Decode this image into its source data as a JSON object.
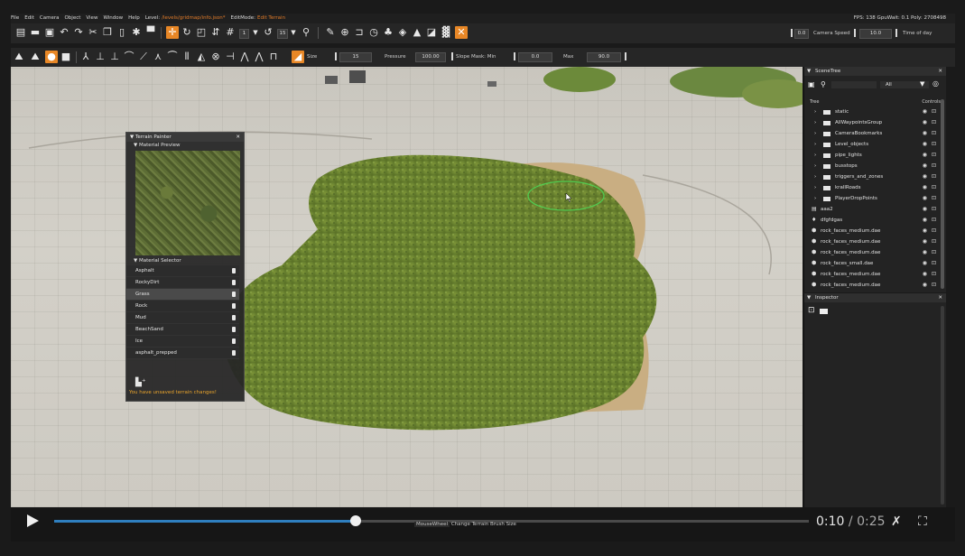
{
  "menubar": {
    "items": [
      "File",
      "Edit",
      "Camera",
      "Object",
      "View",
      "Window",
      "Help"
    ],
    "level_label": "Level:",
    "level_value": "/levels/gridmap/info.json*",
    "editmode_label": "EditMode:",
    "editmode_value": "Edit Terrain",
    "stats": "FPS: 138  GpuWait: 0.1  Poly: 2708498"
  },
  "toolbar1": {
    "num_a": "1",
    "num_b": "15",
    "camera_value": "0.0",
    "camera_speed_label": "Camera Speed",
    "camera_speed_value": "10.0",
    "time_of_day_label": "Time of day"
  },
  "toolbar2": {
    "size_label": "Size",
    "size_value": "15",
    "pressure_label": "Pressure",
    "pressure_value": "100.00",
    "slope_label": "Slope Mask: Min",
    "slope_min": "0.0",
    "max_label": "Max",
    "slope_max": "90.0"
  },
  "terrain_painter": {
    "title": "Terrain Painter",
    "close": "✕",
    "preview_header": "Material Preview",
    "selector_header": "Material Selector",
    "materials": [
      "Asphalt",
      "RockyDirt",
      "Grass",
      "Rock",
      "Mud",
      "BeachSand",
      "Ice",
      "asphalt_prepped"
    ],
    "selected": "Grass",
    "warning": "You have unsaved terrain changes!"
  },
  "scenetree": {
    "title": "SceneTree",
    "close": "✕",
    "filter": "All",
    "col_tree": "Tree",
    "col_controls": "Controls",
    "folders": [
      "static",
      "AllWaypointsGroup",
      "CameraBookmarks",
      "Level_objects",
      "pipe_lights",
      "busstops",
      "triggers_and_zones",
      "krallRoads",
      "PlayerDropPoints"
    ],
    "objects": [
      "aaa2",
      "dfgfdgas",
      "rock_faces_medium.dae",
      "rock_faces_medium.dae",
      "rock_faces_medium.dae",
      "rock_faces_small.dae",
      "rock_faces_medium.dae",
      "rock_faces_medium.dae"
    ]
  },
  "inspector": {
    "title": "Inspector",
    "close": "✕"
  },
  "player": {
    "current_time": "0:10",
    "separator": " / ",
    "total_time": "0:25",
    "progress": 0.4,
    "hint_key": "MouseWheel",
    "hint_text": "Change Terrain Brush Size"
  },
  "colors": {
    "accent": "#e88726",
    "progress": "#2f7fbf",
    "warning": "#e9a42c"
  }
}
